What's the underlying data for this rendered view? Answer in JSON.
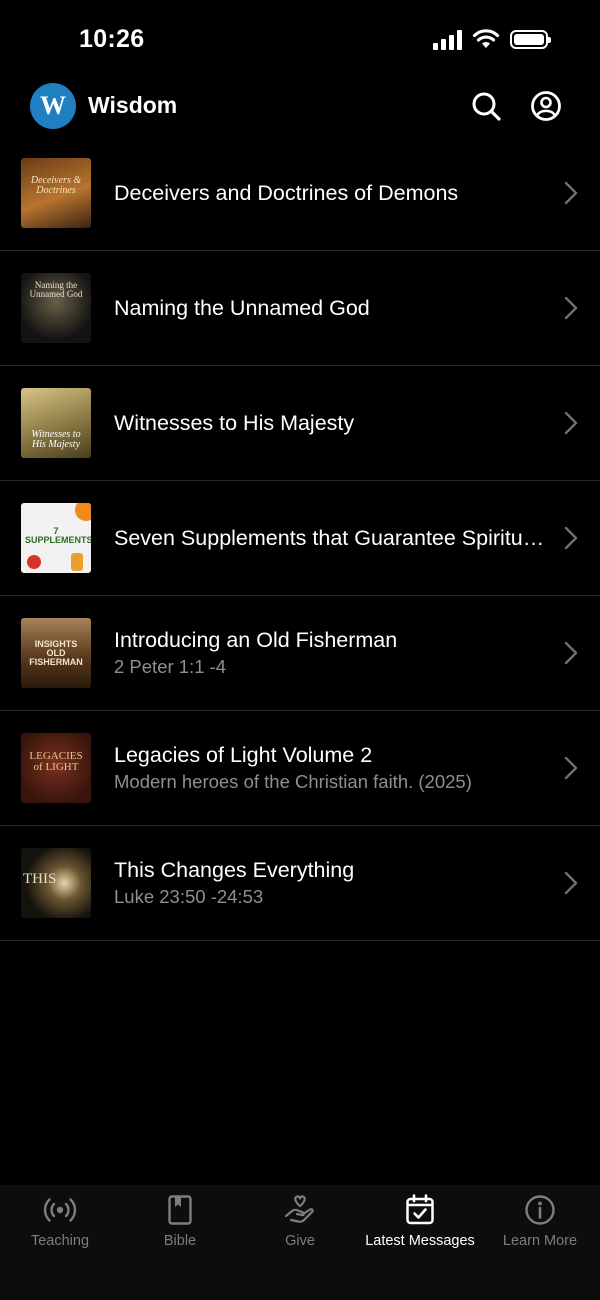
{
  "status_bar": {
    "time": "10:26"
  },
  "header": {
    "app_name": "Wisdom",
    "logo_letter": "W",
    "search_icon": "search-icon",
    "account_icon": "person-circle-icon"
  },
  "items": [
    {
      "title": "Deceivers and Doctrines of Demons",
      "subtitle": "",
      "thumb_text": "Deceivers & Doctrines",
      "thumb_colors": [
        "#6a3b18",
        "#c98a3f"
      ]
    },
    {
      "title": "Naming the Unnamed God",
      "subtitle": "",
      "thumb_text": "Naming the Unnamed God",
      "thumb_colors": [
        "#0f0f0f",
        "#4a4438"
      ]
    },
    {
      "title": "Witnesses to His Majesty",
      "subtitle": "",
      "thumb_text": "Witnesses to His Majesty",
      "thumb_colors": [
        "#6b5a2c",
        "#d8c486"
      ]
    },
    {
      "title": "Seven Supplements that Guarantee Spiritual Strength",
      "subtitle": "",
      "thumb_text": "7 SUPPLEMENTS",
      "thumb_colors": [
        "#f4f4f4",
        "#f2f2f2"
      ]
    },
    {
      "title": "Introducing an Old Fisherman",
      "subtitle": "2 Peter 1:1 -4",
      "thumb_text": "INSIGHTS OLD FISHERMAN",
      "thumb_colors": [
        "#3a2212",
        "#9c6a3a"
      ]
    },
    {
      "title": "Legacies of Light Volume 2",
      "subtitle": "Modern heroes of the Christian faith. (2025)",
      "thumb_text": "LEGACIES of LIGHT",
      "thumb_colors": [
        "#3d160f",
        "#6e2a18"
      ]
    },
    {
      "title": "This Changes Everything",
      "subtitle": "Luke 23:50 -24:53",
      "thumb_text": "THIS",
      "thumb_colors": [
        "#14120d",
        "#b89a63"
      ]
    }
  ],
  "tabs": [
    {
      "label": "Teaching",
      "icon": "broadcast-icon",
      "active": false
    },
    {
      "label": "Bible",
      "icon": "book-icon",
      "active": false
    },
    {
      "label": "Give",
      "icon": "hand-heart-icon",
      "active": false
    },
    {
      "label": "Latest Messages",
      "icon": "calendar-check-icon",
      "active": true
    },
    {
      "label": "Learn More",
      "icon": "info-circle-icon",
      "active": false
    }
  ],
  "colors": {
    "accent": "#1f7fc1",
    "background": "#000000",
    "secondary_text": "#8e8e93",
    "tab_inactive": "#7d7d82"
  }
}
